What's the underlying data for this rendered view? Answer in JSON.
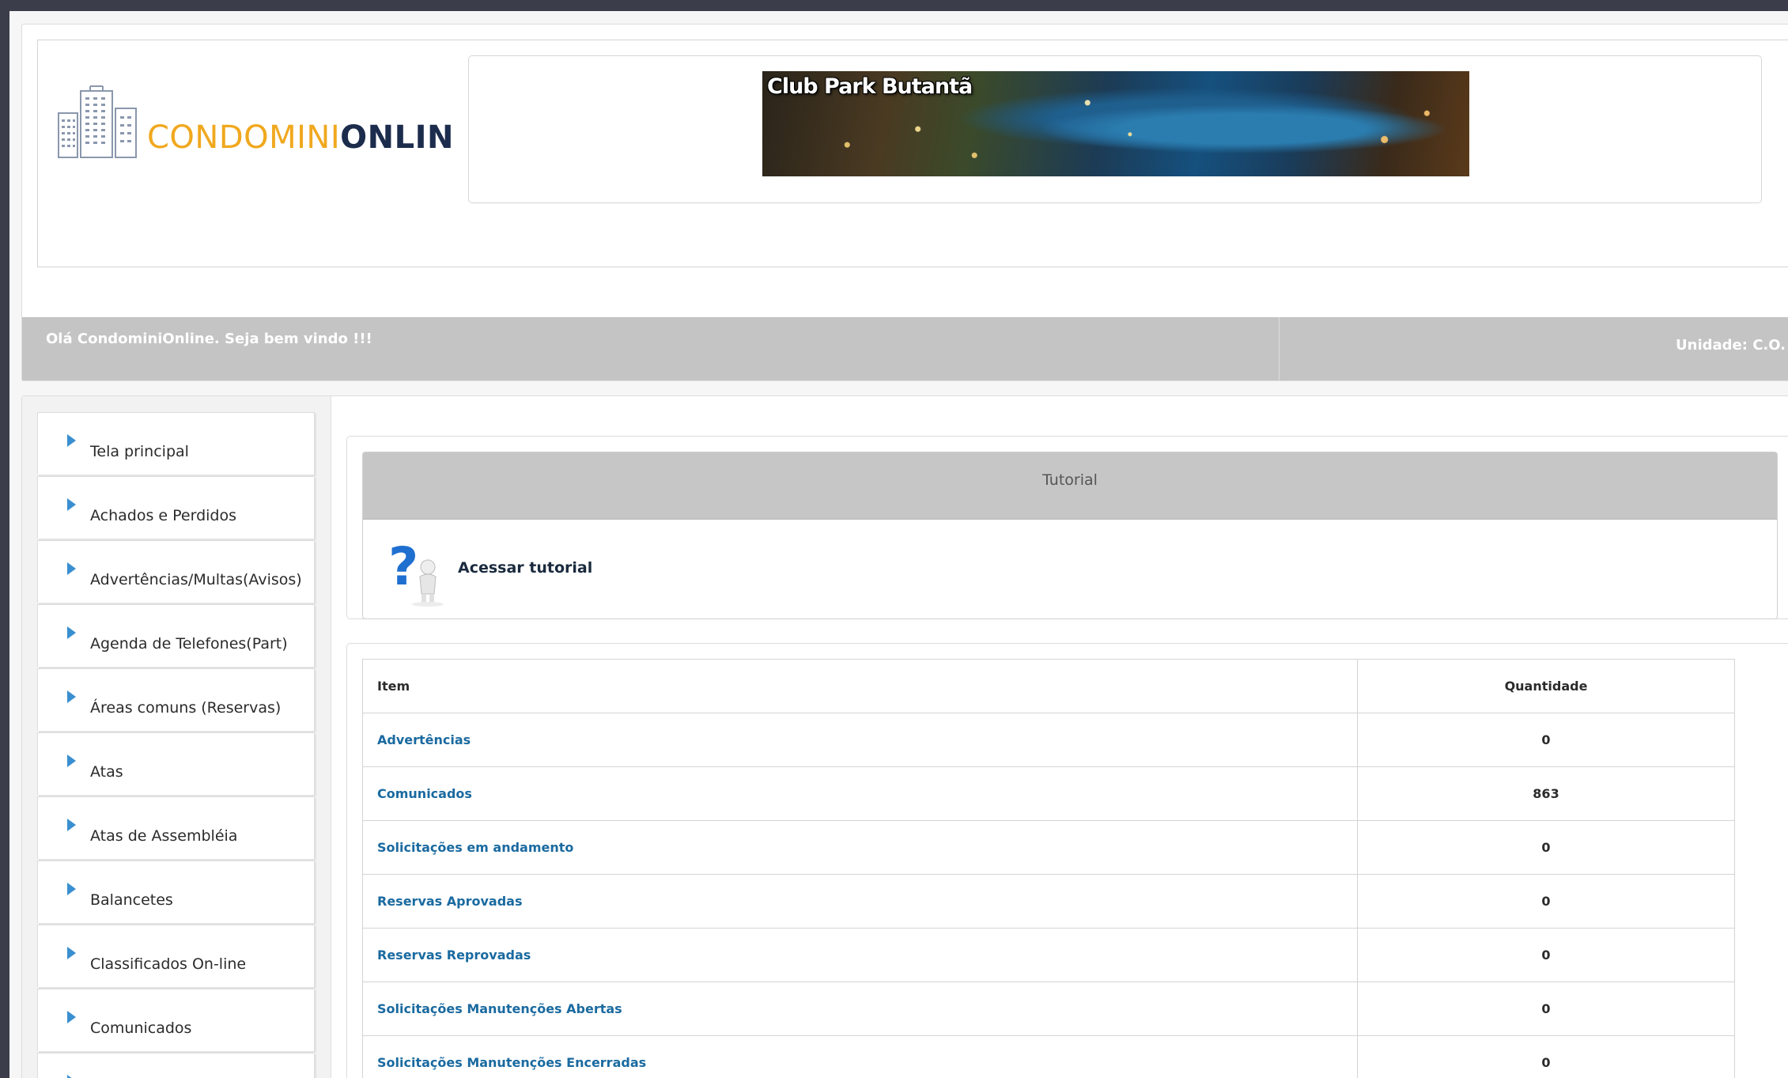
{
  "header": {
    "logo": {
      "part1": "CONDOMINI",
      "part2": "ONLINE"
    },
    "banner_title": "Club Park Butantã",
    "welcome": "Olá CondominiOnline. Seja bem vindo !!!",
    "unit": "Unidade: C.O."
  },
  "sidebar": {
    "items": [
      {
        "label": "Tela principal"
      },
      {
        "label": "Achados e Perdidos"
      },
      {
        "label": "Advertências/Multas(Avisos)"
      },
      {
        "label": "Agenda de Telefones(Part)"
      },
      {
        "label": "Áreas comuns (Reservas)"
      },
      {
        "label": "Atas"
      },
      {
        "label": "Atas de Assembléia"
      },
      {
        "label": "Balancetes"
      },
      {
        "label": "Classificados On-line"
      },
      {
        "label": "Comunicados"
      },
      {
        "label": ""
      }
    ]
  },
  "tutorial": {
    "header": "Tutorial",
    "link": "Acessar tutorial"
  },
  "table": {
    "headers": {
      "item": "Item",
      "quantity": "Quantidade"
    },
    "rows": [
      {
        "item": "Advertências",
        "qty": "0"
      },
      {
        "item": "Comunicados",
        "qty": "863"
      },
      {
        "item": "Solicitações em andamento",
        "qty": "0"
      },
      {
        "item": "Reservas Aprovadas",
        "qty": "0"
      },
      {
        "item": "Reservas Reprovadas",
        "qty": "0"
      },
      {
        "item": "Solicitações Manutenções Abertas",
        "qty": "0"
      },
      {
        "item": "Solicitações Manutenções Encerradas",
        "qty": "0"
      }
    ]
  },
  "colors": {
    "accent": "#3a8fd0",
    "link": "#1a6aa0",
    "logo_orange": "#f0a81e",
    "logo_navy": "#1c2c4c",
    "bar_gray": "#c4c4c4"
  }
}
